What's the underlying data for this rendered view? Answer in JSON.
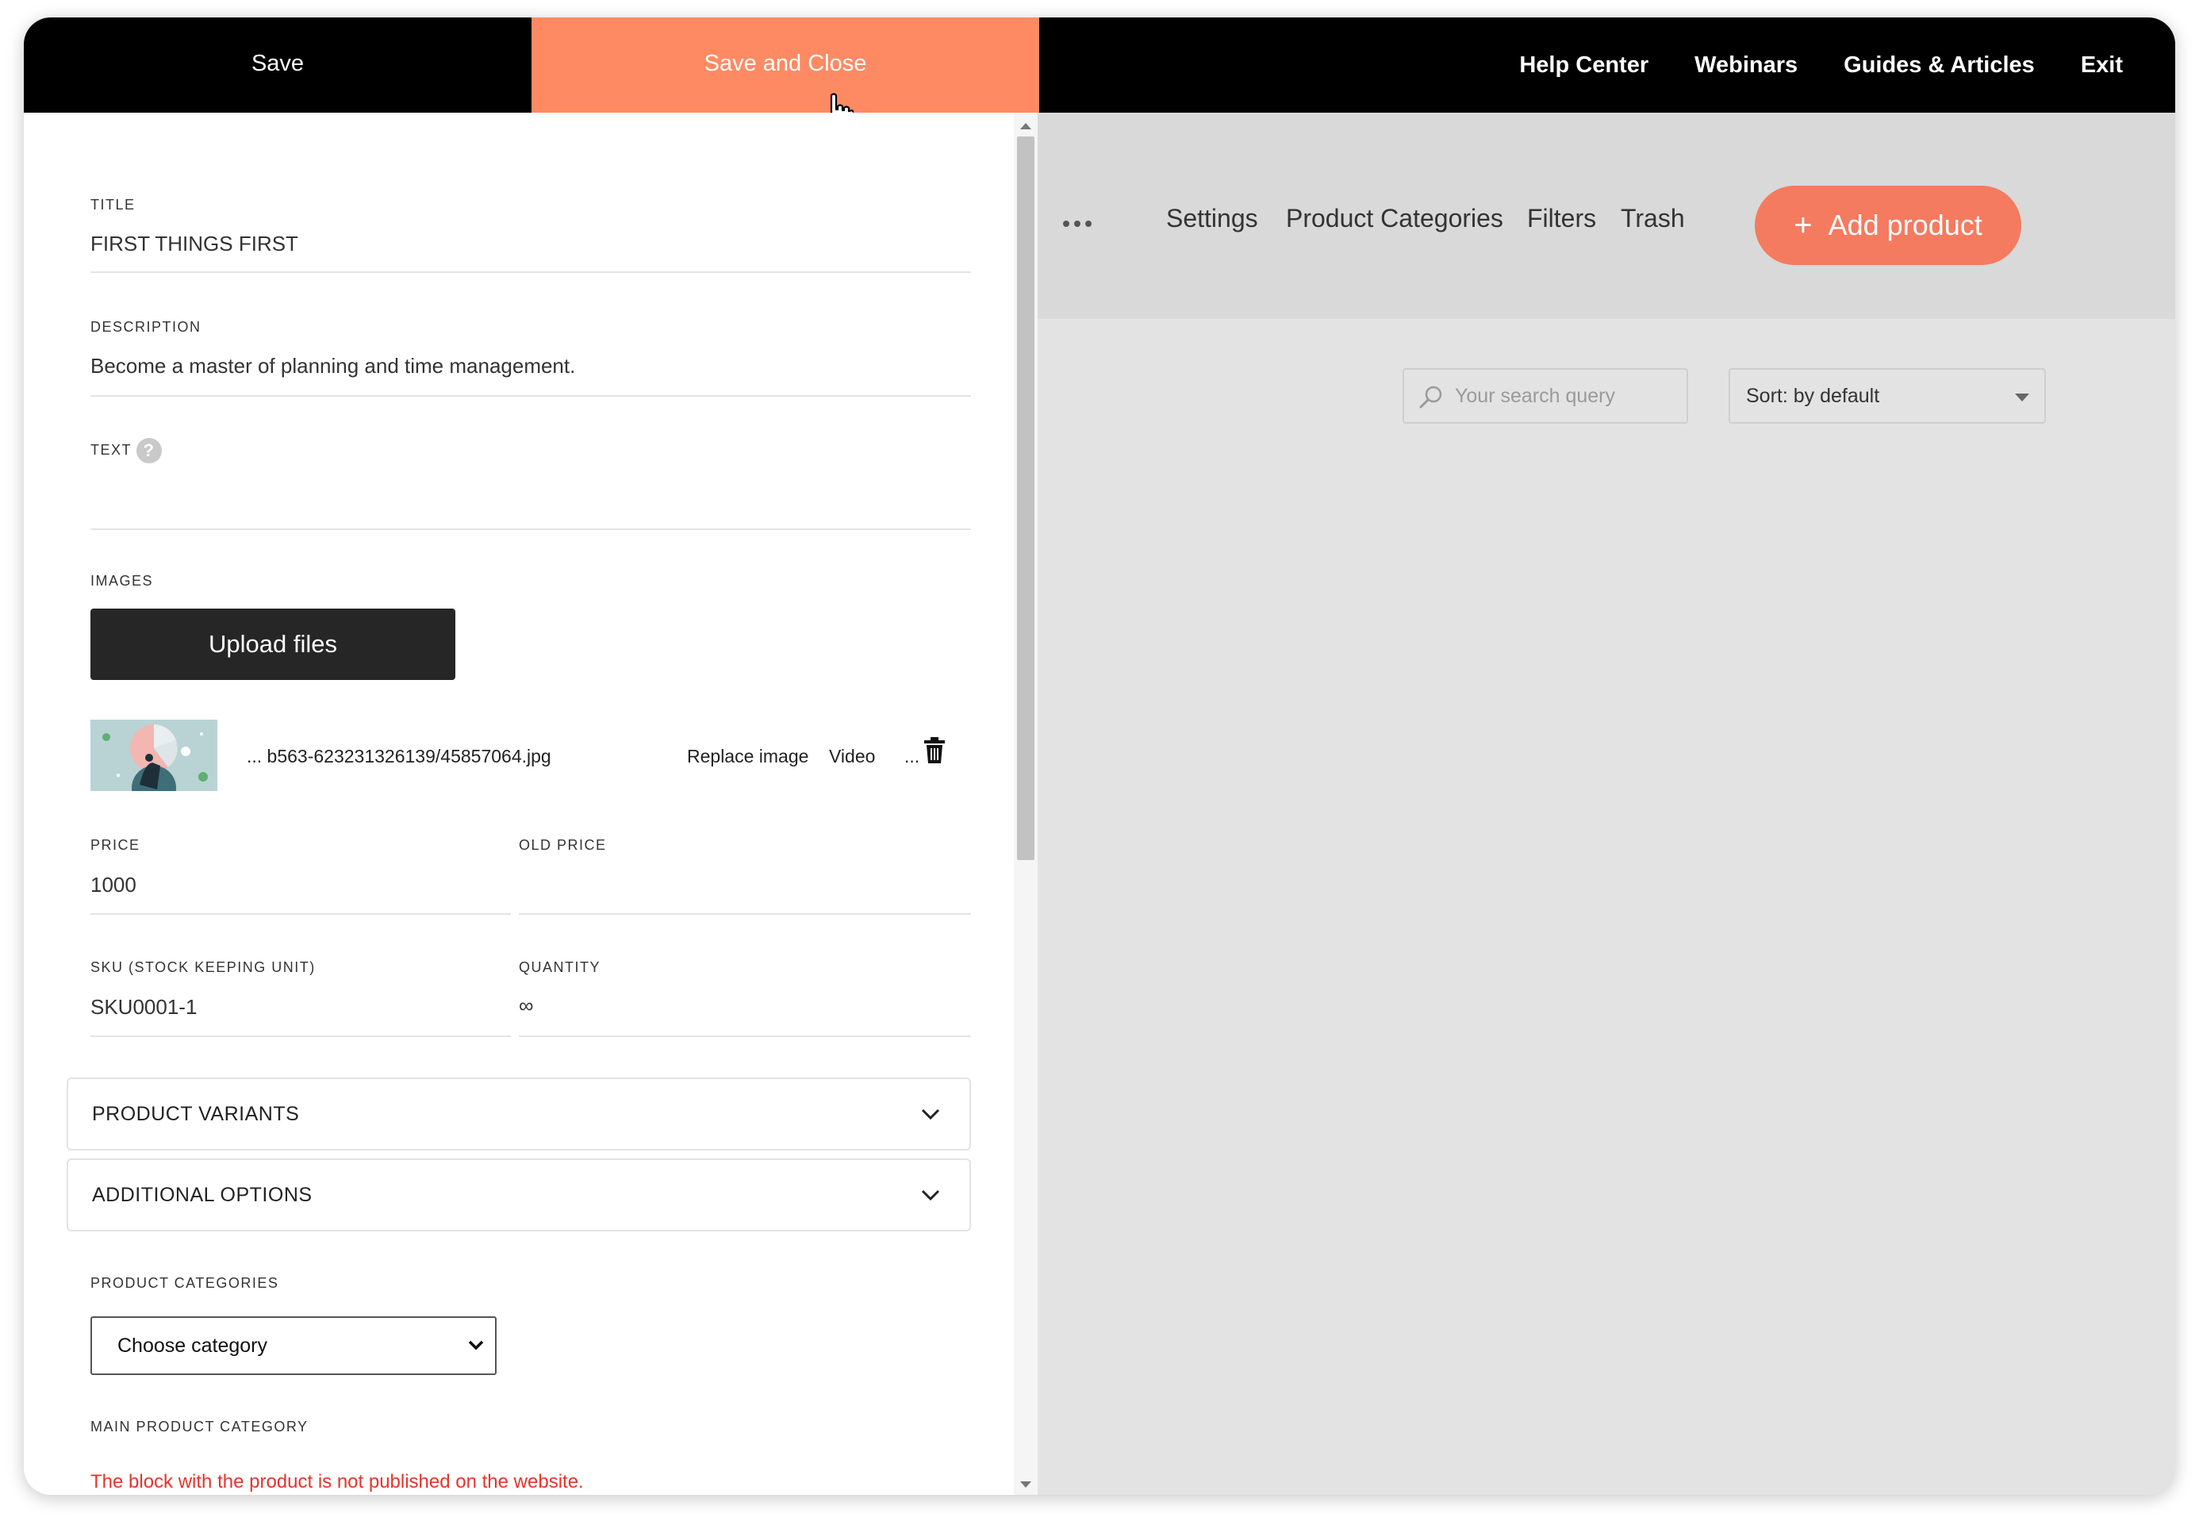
{
  "topbar": {
    "save_label": "Save",
    "save_close_label": "Save and Close",
    "links": [
      "Help Center",
      "Webinars",
      "Guides & Articles",
      "Exit"
    ]
  },
  "editor": {
    "title": {
      "label": "TITLE",
      "value": "FIRST THINGS FIRST"
    },
    "description": {
      "label": "DESCRIPTION",
      "value": "Become a master of planning and time management."
    },
    "text": {
      "label": "TEXT",
      "help": "?"
    },
    "images": {
      "label": "IMAGES",
      "upload_label": "Upload files",
      "file_name": "... b563-623231326139/45857064.jpg",
      "replace_label": "Replace image",
      "video_label": "Video",
      "more_label": "..."
    },
    "price": {
      "label": "PRICE",
      "value": "1000"
    },
    "old_price": {
      "label": "OLD PRICE",
      "value": ""
    },
    "sku": {
      "label": "SKU (STOCK KEEPING UNIT)",
      "value": "SKU0001-1"
    },
    "quantity": {
      "label": "QUANTITY",
      "value": "∞"
    },
    "accordions": [
      "PRODUCT VARIANTS",
      "ADDITIONAL OPTIONS"
    ],
    "categories": {
      "label": "PRODUCT CATEGORIES",
      "selected": "Choose category"
    },
    "main_category": {
      "label": "MAIN PRODUCT CATEGORY"
    },
    "warning": "The block with the product is not published on the website."
  },
  "store": {
    "nav": [
      "Settings",
      "Product Categories",
      "Filters",
      "Trash"
    ],
    "add_button": "Add product",
    "add_icon": "+",
    "search_placeholder": "Your search query",
    "sort_label": "Sort: by default"
  },
  "colors": {
    "accent": "#fd8a63",
    "add_button": "#f47b5f",
    "warning": "#e4352b"
  }
}
